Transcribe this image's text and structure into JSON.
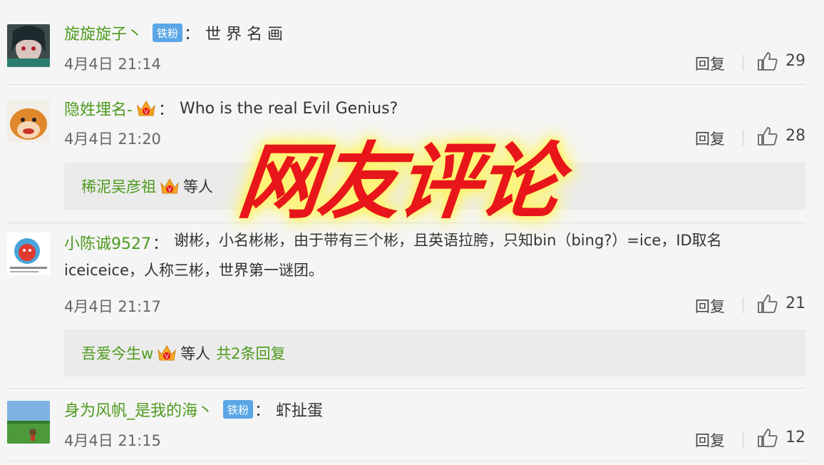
{
  "comments": [
    {
      "username": "旋旋旋子丶",
      "badge": "铁粉",
      "text": "世 界 名 画",
      "time": "4月4日 21:14",
      "reply_label": "回复",
      "likes": "29"
    },
    {
      "username": "隐姓埋名-",
      "text": "Who is the real Evil Genius?",
      "time": "4月4日 21:20",
      "reply_label": "回复",
      "likes": "28",
      "sub": {
        "username": "稀泥吴彦祖",
        "deng": "等人"
      }
    },
    {
      "username": "小陈诚9527",
      "text_line1": "谢彬，小名彬彬，由于带有三个彬，且英语拉胯，只知bin（bing?）=ice，ID取名",
      "text_line2": "iceiceice，人称三彬，世界第一谜团。",
      "time": "4月4日 21:17",
      "reply_label": "回复",
      "likes": "21",
      "sub": {
        "username": "吾爱今生w",
        "deng": "等人",
        "count": "共2条回复"
      }
    },
    {
      "username": "身为风帆_是我的海丶",
      "badge": "铁粉",
      "text": "虾扯蛋",
      "time": "4月4日 21:15",
      "reply_label": "回复",
      "likes": "12"
    }
  ],
  "overlay_title": "网友评论",
  "colors": {
    "username": "#4e9a1e",
    "badge": "#5aa6e6",
    "overlay": "#e8161a",
    "glow": "#fff56a"
  }
}
